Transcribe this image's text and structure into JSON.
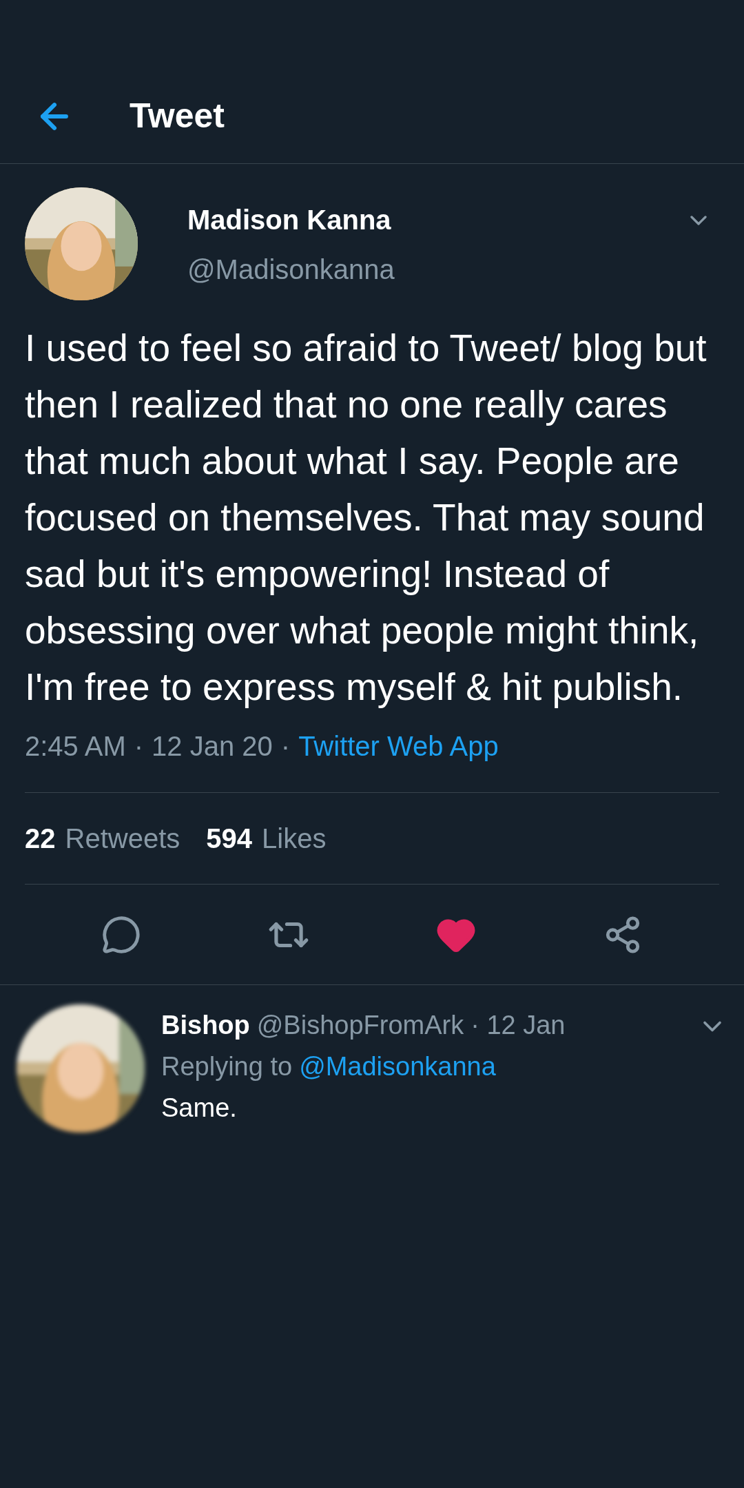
{
  "header": {
    "title": "Tweet"
  },
  "tweet": {
    "name": "Madison Kanna",
    "handle": "@Madisonkanna",
    "text": "I used to feel so afraid to Tweet/ blog but then I realized that no one really cares that much about what I say. People are focused on themselves. That may sound sad but it's empowering! Instead of obsessing over what people might think, I'm free to express myself & hit publish.",
    "time": "2:45 AM",
    "separator_1": "·",
    "date": "12 Jan 20",
    "separator_2": "·",
    "source": "Twitter Web App",
    "retweets": "22",
    "retweets_label": "Retweets",
    "likes": "594",
    "likes_label": "Likes",
    "liked": true
  },
  "reply": {
    "name": "Bishop",
    "handle": "@BishopFromArk",
    "date": "· 12 Jan",
    "replying_to": "Replying to",
    "mention": "@Madisonkanna",
    "text": "Same."
  }
}
